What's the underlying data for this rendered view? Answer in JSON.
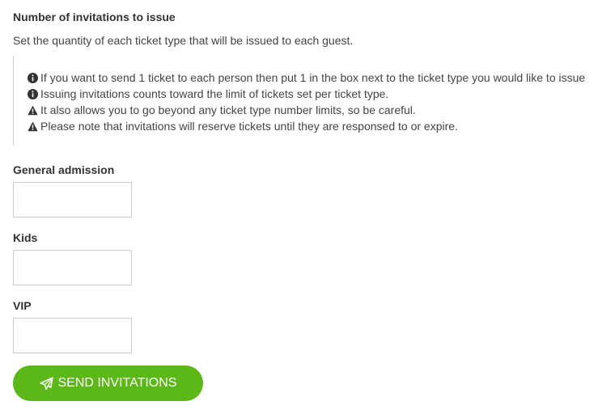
{
  "header": {
    "title": "Number of invitations to issue",
    "subtitle": "Set the quantity of each ticket type that will be issued to each guest."
  },
  "notes": [
    {
      "icon": "info-circle-icon",
      "text": "If you want to send 1 ticket to each person then put 1 in the box next to the ticket type you would like to issue"
    },
    {
      "icon": "info-circle-icon",
      "text": "Issuing invitations counts toward the limit of tickets set per ticket type."
    },
    {
      "icon": "warning-triangle-icon",
      "text": "It also allows you to go beyond any ticket type number limits, so be careful."
    },
    {
      "icon": "warning-triangle-icon",
      "text": "Please note that invitations will reserve tickets until they are responsed to or expire."
    }
  ],
  "fields": [
    {
      "label": "General admission",
      "value": ""
    },
    {
      "label": "Kids",
      "value": ""
    },
    {
      "label": "VIP",
      "value": ""
    }
  ],
  "actions": {
    "send_label": "SEND INVITATIONS",
    "send_icon": "paper-plane-icon"
  },
  "colors": {
    "accent": "#5cb818",
    "border": "#cccccc",
    "text": "#333333"
  }
}
